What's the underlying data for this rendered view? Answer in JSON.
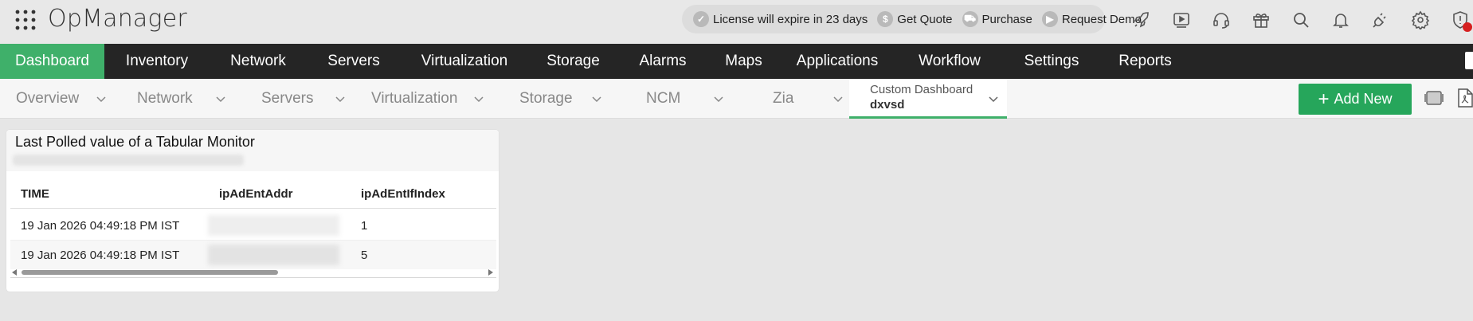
{
  "app": {
    "title": "OpManager"
  },
  "license_bar": {
    "license_text": "License will expire in 23 days",
    "get_quote": "Get Quote",
    "purchase": "Purchase",
    "request_demo": "Request Demo"
  },
  "top_icons": [
    "rocket-icon",
    "video-icon",
    "headset-icon",
    "gift-icon",
    "search-icon",
    "bell-icon",
    "plug-icon",
    "gear-icon",
    "shield-alert-icon"
  ],
  "main_nav": {
    "items": [
      "Dashboard",
      "Inventory",
      "Network",
      "Servers",
      "Virtualization",
      "Storage",
      "Alarms",
      "Maps",
      "Applications",
      "Workflow",
      "Settings",
      "Reports"
    ],
    "active": "Dashboard"
  },
  "sub_nav": {
    "items": [
      "Overview",
      "Network",
      "Servers",
      "Virtualization",
      "Storage",
      "NCM",
      "Zia"
    ],
    "custom_label": "Custom Dashboard",
    "custom_name": "dxvsd",
    "add_new": "Add New"
  },
  "widget": {
    "title": "Last Polled value of a Tabular Monitor",
    "columns": [
      "TIME",
      "ipAdEntAddr",
      "ipAdEntIfIndex"
    ],
    "rows": [
      {
        "time": "19 Jan 2026 04:49:18 PM IST",
        "addr": "",
        "ifindex": "1"
      },
      {
        "time": "19 Jan 2026 04:49:18 PM IST",
        "addr": "",
        "ifindex": "5"
      }
    ]
  },
  "colors": {
    "accent": "#3fb06a",
    "button": "#26a65b",
    "nav_bg": "#252525"
  }
}
